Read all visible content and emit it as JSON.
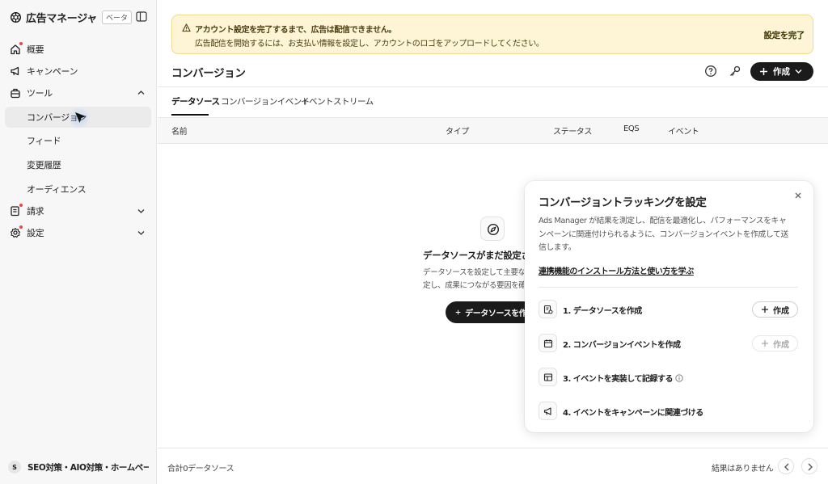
{
  "sidebar": {
    "app_title": "広告マネージャ",
    "beta_badge": "ベータ",
    "items": [
      {
        "label": "概要",
        "icon": "home-icon"
      },
      {
        "label": "キャンペーン",
        "icon": "megaphone-icon"
      },
      {
        "label": "ツール",
        "icon": "toolbox-icon"
      },
      {
        "label": "コンバージョン"
      },
      {
        "label": "フィード"
      },
      {
        "label": "変更履歴"
      },
      {
        "label": "オーディエンス"
      },
      {
        "label": "請求",
        "icon": "billing-icon"
      },
      {
        "label": "設定",
        "icon": "gear-icon"
      }
    ],
    "account": {
      "initial": "S",
      "name": "SEO対策・AIO対策・ホームページ..."
    }
  },
  "banner": {
    "title": "アカウント設定を完了するまで、広告は配信できません。",
    "body": "広告配信を開始するには、お支払い情報を設定し、アカウントのロゴをアップロードしてください。",
    "action": "設定を完了"
  },
  "header": {
    "title": "コンバージョン",
    "create_label": "作成"
  },
  "tabs": [
    "データソース",
    "コンバージョンイベント",
    "イベントストリーム"
  ],
  "table": {
    "columns": [
      "名前",
      "タイプ",
      "ステータス",
      "EQS",
      "イベント"
    ]
  },
  "empty_state": {
    "title": "データソースがまだ設定され",
    "description_line1": "データソースを設定して主要なア",
    "description_line2": "定し、成果につながる要因を確",
    "button": "データソースを作成"
  },
  "footer": {
    "count": "合計0データソース",
    "no_results": "結果はありません"
  },
  "panel": {
    "title": "コンバージョントラッキングを設定",
    "description": "Ads Manager が結果を測定し、配信を最適化し、パフォーマンスをキャンペーンに関連付けられるように、コンバージョンイベントを作成して送信します。",
    "link": "連携機能のインストール方法と使い方を学ぶ",
    "steps": [
      {
        "label": "1. データソースを作成",
        "button": "作成"
      },
      {
        "label": "2. コンバージョンイベントを作成",
        "button": "作成"
      },
      {
        "label": "3. イベントを実装して記録する"
      },
      {
        "label": "4. イベントをキャンペーンに関連づける"
      }
    ]
  },
  "colors": {
    "accent_dark": "#1b1b1b",
    "banner_bg": "#fdf5d6",
    "banner_border": "#f1d98e",
    "badge_red": "#e5484d",
    "active_nav": "#ebebeb"
  }
}
